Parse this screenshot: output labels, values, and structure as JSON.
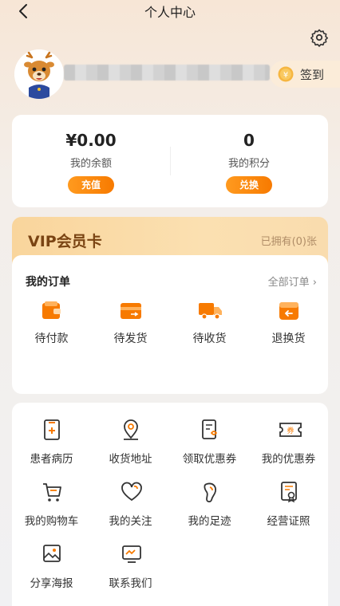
{
  "header": {
    "title": "个人中心"
  },
  "profile": {
    "checkin_label": "签到"
  },
  "balance": {
    "amount": "¥0.00",
    "amount_caption": "我的余额",
    "recharge_label": "充值",
    "points": "0",
    "points_caption": "我的积分",
    "redeem_label": "兑换"
  },
  "vip": {
    "title": "VIP会员卡",
    "owned": "已拥有(0)张"
  },
  "orders": {
    "title": "我的订单",
    "all_label": "全部订单",
    "items": [
      {
        "label": "待付款",
        "icon": "wallet-icon"
      },
      {
        "label": "待发货",
        "icon": "card-icon"
      },
      {
        "label": "待收货",
        "icon": "truck-icon"
      },
      {
        "label": "退换货",
        "icon": "return-icon"
      }
    ]
  },
  "services": [
    {
      "label": "患者病历",
      "icon": "medical-record-icon"
    },
    {
      "label": "收货地址",
      "icon": "location-icon"
    },
    {
      "label": "领取优惠券",
      "icon": "claim-coupon-icon"
    },
    {
      "label": "我的优惠券",
      "icon": "coupon-icon"
    },
    {
      "label": "我的购物车",
      "icon": "cart-icon"
    },
    {
      "label": "我的关注",
      "icon": "heart-icon"
    },
    {
      "label": "我的足迹",
      "icon": "footprint-icon"
    },
    {
      "label": "经营证照",
      "icon": "license-icon"
    },
    {
      "label": "分享海报",
      "icon": "poster-icon"
    },
    {
      "label": "联系我们",
      "icon": "contact-icon"
    }
  ],
  "colors": {
    "accent": "#f77a00",
    "accent_light": "#ff9a1f",
    "vip_text": "#7a4413"
  }
}
